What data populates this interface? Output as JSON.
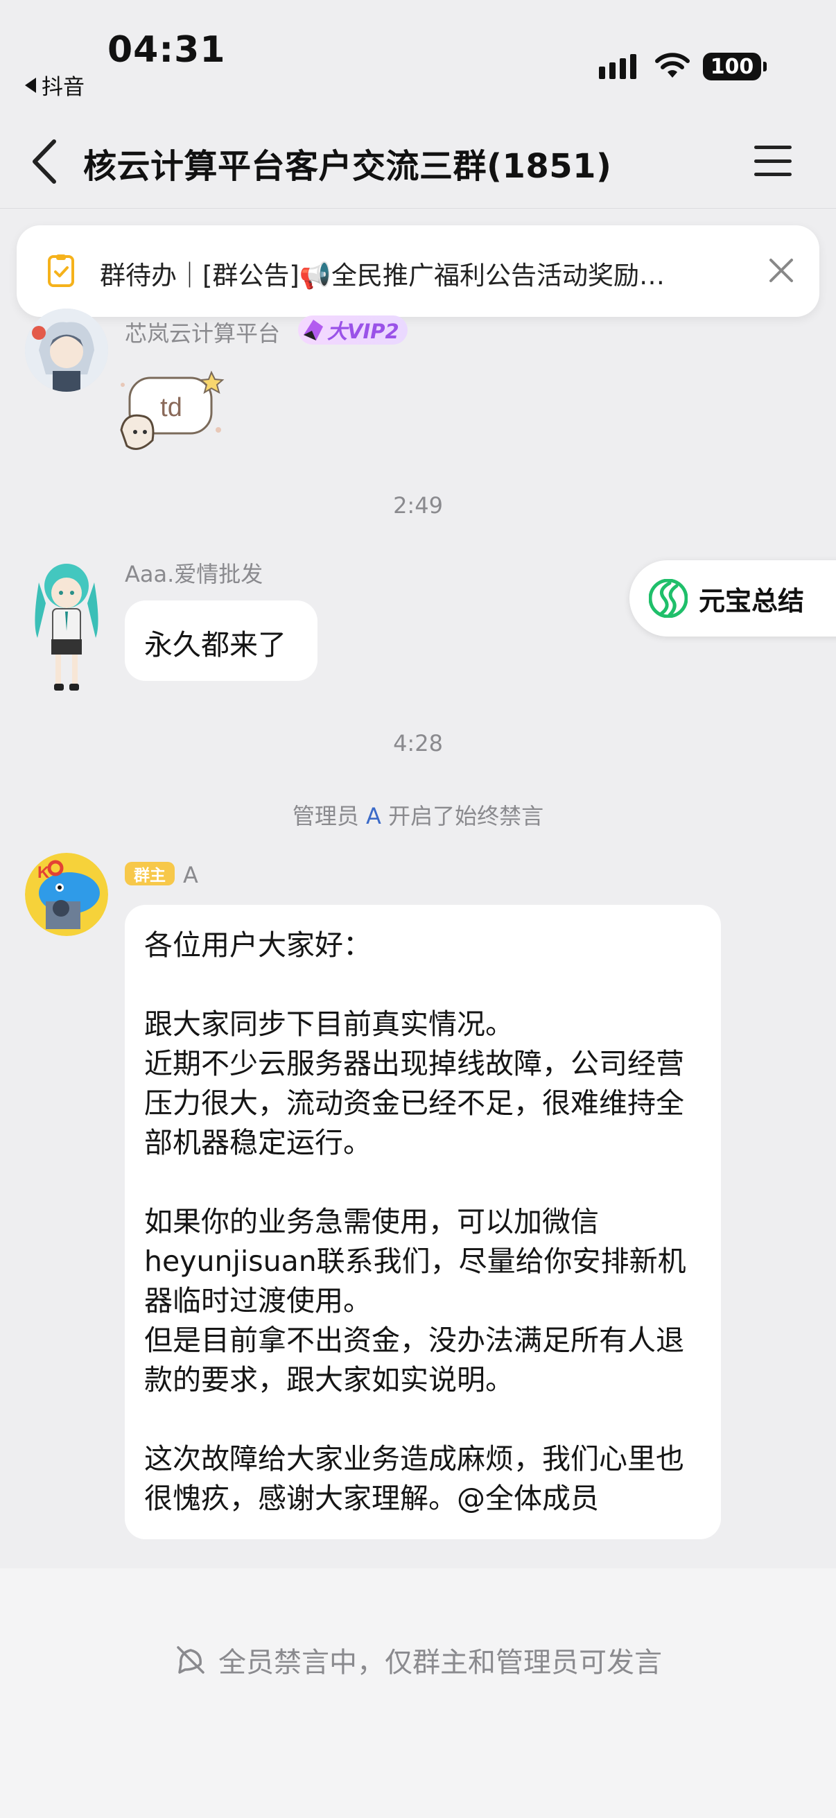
{
  "status_bar": {
    "time": "04:31",
    "back_app": "抖音",
    "battery": "100"
  },
  "header": {
    "title": "核云计算平台客户交流三群(1851)"
  },
  "notice": {
    "text": "群待办｜[群公告]📢全民推广福利公告活动奖励…"
  },
  "messages": [
    {
      "sender": "芯岚云计算平台",
      "badge": "大VIP2",
      "sticker_text": "td"
    },
    {
      "timestamp": "2:49",
      "sender": "Aaa.爱情批发",
      "text": "永久都来了"
    },
    {
      "timestamp": "4:28",
      "system_prefix": "管理员",
      "system_who": "A",
      "system_suffix": "开启了始终禁言"
    },
    {
      "badge": "群主",
      "sender": "A",
      "text": "各位用户大家好：\n\n跟大家同步下目前真实情况。\n近期不少云服务器出现掉线故障，公司经营压力很大，流动资金已经不足，很难维持全部机器稳定运行。\n\n如果你的业务急需使用，可以加微信heyunjisuan联系我们，尽量给你安排新机器临时过渡使用。\n但是目前拿不出资金，没办法满足所有人退款的要求，跟大家如实说明。\n\n这次故障给大家业务造成麻烦，我们心里也很愧疚，感谢大家理解。@全体成员"
    }
  ],
  "summary_button": {
    "label": "元宝总结"
  },
  "footer": {
    "muted_text": "全员禁言中，仅群主和管理员可发言"
  }
}
